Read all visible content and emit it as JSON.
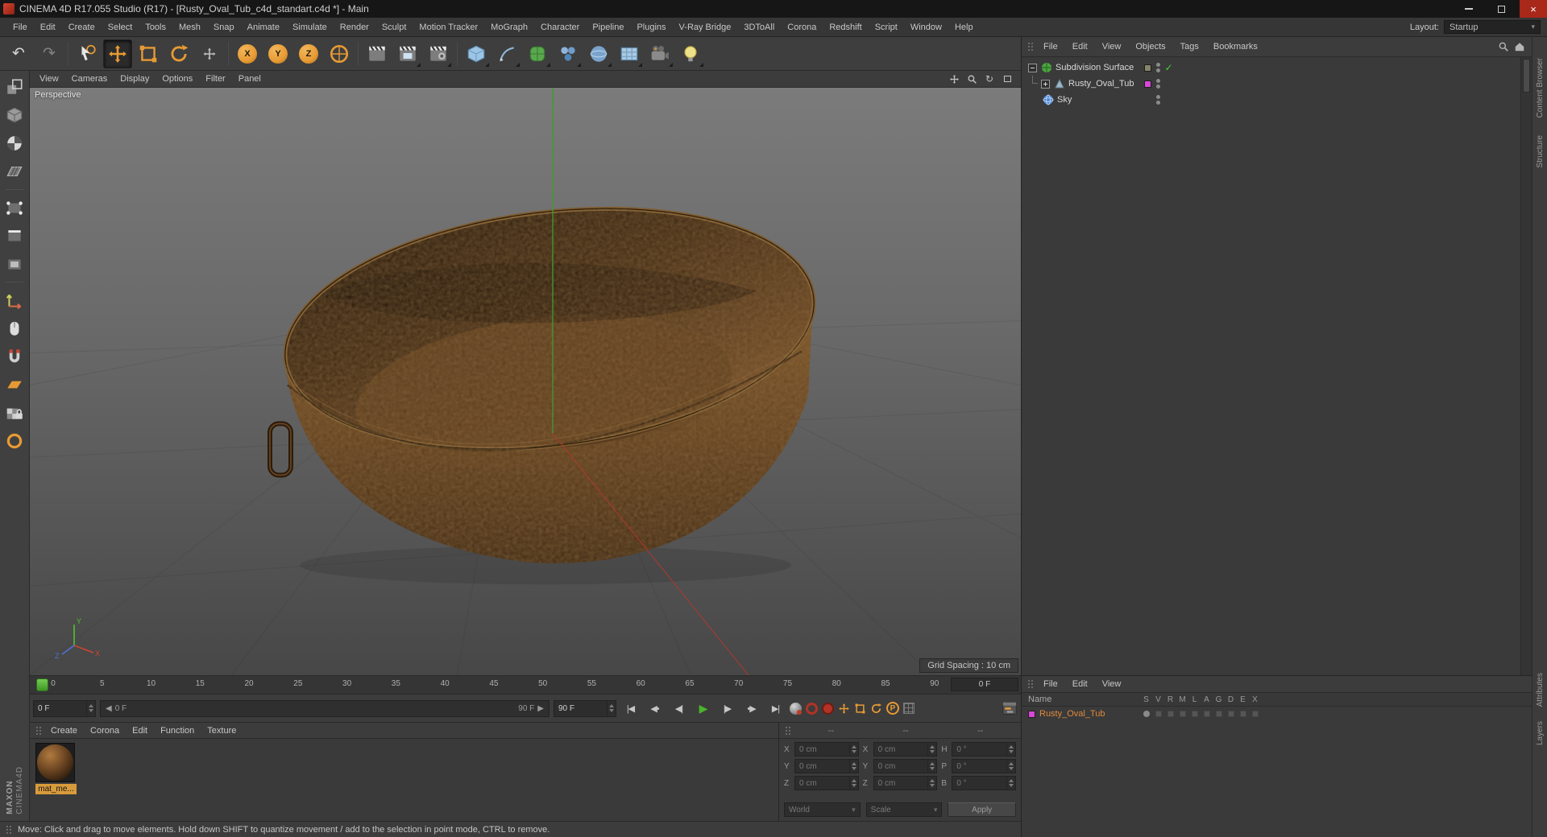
{
  "window": {
    "title": "CINEMA 4D R17.055 Studio (R17) - [Rusty_Oval_Tub_c4d_standart.c4d *] - Main"
  },
  "menubar": {
    "items": [
      "File",
      "Edit",
      "Create",
      "Select",
      "Tools",
      "Mesh",
      "Snap",
      "Animate",
      "Simulate",
      "Render",
      "Sculpt",
      "Motion Tracker",
      "MoGraph",
      "Character",
      "Pipeline",
      "Plugins",
      "V-Ray Bridge",
      "3DToAll",
      "Corona",
      "Redshift",
      "Script",
      "Window",
      "Help"
    ],
    "layout_label": "Layout:",
    "layout_value": "Startup"
  },
  "toolbar": {
    "axis_letters": [
      "X",
      "Y",
      "Z"
    ]
  },
  "viewport": {
    "menu": [
      "View",
      "Cameras",
      "Display",
      "Options",
      "Filter",
      "Panel"
    ],
    "view_label": "Perspective",
    "grid_spacing": "Grid Spacing : 10 cm",
    "axis_x": "X",
    "axis_y": "Y",
    "axis_z": "Z"
  },
  "timeline": {
    "ticks": [
      "0",
      "5",
      "10",
      "15",
      "20",
      "25",
      "30",
      "35",
      "40",
      "45",
      "50",
      "55",
      "60",
      "65",
      "70",
      "75",
      "80",
      "85",
      "90"
    ],
    "current_frame_box": "0 F",
    "frame_field": "0 F",
    "slider_left": "0 F",
    "slider_right": "90 F",
    "end_field": "90 F"
  },
  "materials_panel": {
    "menu": [
      "Create",
      "Corona",
      "Edit",
      "Function",
      "Texture"
    ],
    "material_name": "mat_me..."
  },
  "coordinates_panel": {
    "headers": [
      "--",
      "--",
      "--"
    ],
    "position_labels": [
      "X",
      "Y",
      "Z"
    ],
    "size_labels": [
      "X",
      "Y",
      "Z"
    ],
    "rotation_labels": [
      "H",
      "P",
      "B"
    ],
    "position_values": [
      "0 cm",
      "0 cm",
      "0 cm"
    ],
    "size_values": [
      "0 cm",
      "0 cm",
      "0 cm"
    ],
    "rotation_values": [
      "0 °",
      "0 °",
      "0 °"
    ],
    "space_dropdown": "World",
    "mode_dropdown": "Scale",
    "apply_button": "Apply"
  },
  "object_manager": {
    "menu": [
      "File",
      "Edit",
      "View",
      "Objects",
      "Tags",
      "Bookmarks"
    ],
    "objects": [
      {
        "name": "Subdivision Surface"
      },
      {
        "name": "Rusty_Oval_Tub"
      },
      {
        "name": "Sky"
      }
    ]
  },
  "layer_manager": {
    "menu": [
      "File",
      "Edit",
      "View"
    ],
    "name_header": "Name",
    "columns": [
      "S",
      "V",
      "R",
      "M",
      "L",
      "A",
      "G",
      "D",
      "E",
      "X"
    ],
    "layer_name": "Rusty_Oval_Tub"
  },
  "status_bar": {
    "text": "Move: Click and drag to move elements. Hold down SHIFT to quantize movement / add to the selection in point mode, CTRL to remove."
  },
  "branding": {
    "maxon": "MAXON",
    "cinema": "CINEMA4D"
  },
  "right_tabs": [
    "Content Browser",
    "Structure",
    "Attributes",
    "Layers"
  ],
  "icons": {
    "undo": "↶",
    "redo": "↷",
    "goto_start": "|◀",
    "prev_key": "◀•",
    "prev_frame": "◀|",
    "play": "▶",
    "next_frame": "|▶",
    "next_key": "•▶",
    "goto_end": "▶|",
    "orbit": "↻",
    "parameter": "P",
    "check": "✓",
    "close": "×",
    "dropdown_arrow": "▾"
  },
  "colors": {
    "accent": "#e79a34",
    "playhead_green": "#4caf2f",
    "layer_magenta": "#d946d9",
    "rust_brown": "#6b4522"
  }
}
